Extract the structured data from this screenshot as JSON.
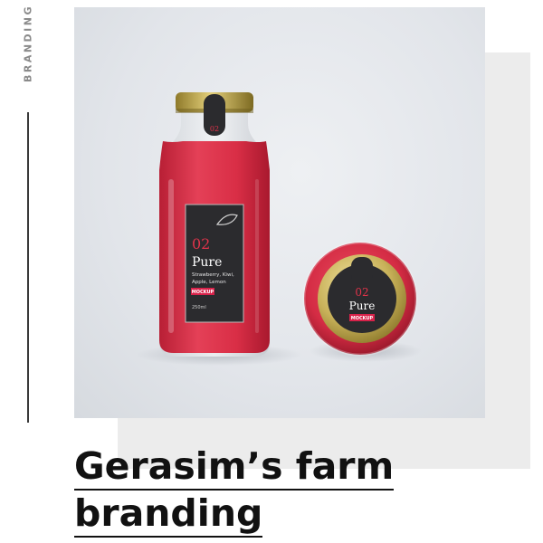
{
  "side_label": "BRANDING",
  "project": {
    "title_line1": "Gerasim’s farm",
    "title_line2": "branding"
  },
  "bottle_label": {
    "number": "02",
    "name": "Pure",
    "flavours_line1": "Strawberry, Kiwi,",
    "flavours_line2": "Apple, Lemon",
    "tag": "MOCKUP",
    "volume": "250ml",
    "cap_tag_number": "02"
  },
  "jar_label": {
    "number": "02",
    "name": "Pure",
    "tag": "MOCKUP"
  },
  "colors": {
    "juice": "#e0334a",
    "label_dark": "#2b2b2e",
    "accent": "#d8224a",
    "lid_gold": "#c9b25a"
  }
}
